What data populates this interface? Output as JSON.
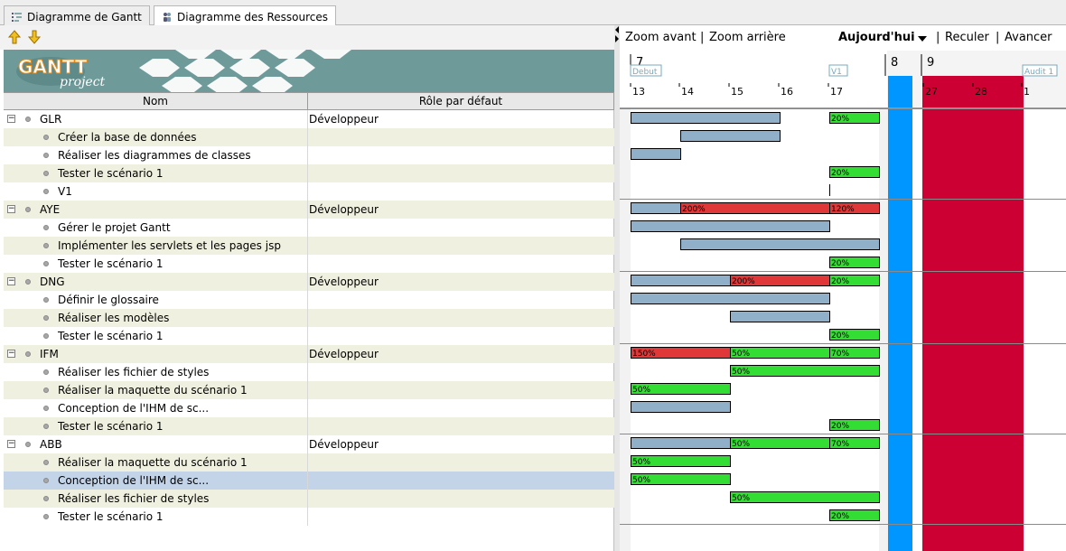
{
  "tabs": [
    {
      "label": "Diagramme de Gantt",
      "active": false
    },
    {
      "label": "Diagramme des Ressources",
      "active": true
    }
  ],
  "logo": {
    "line1": "GANTT",
    "line2": "project"
  },
  "columns": {
    "name": "Nom",
    "role": "Rôle par défaut"
  },
  "rows": [
    {
      "type": "resource",
      "name": "GLR",
      "role": "Développeur"
    },
    {
      "type": "task",
      "name": "Créer la base de données"
    },
    {
      "type": "task",
      "name": "Réaliser les diagrammes de classes"
    },
    {
      "type": "task",
      "name": "Tester le scénario 1"
    },
    {
      "type": "task",
      "name": "V1"
    },
    {
      "type": "resource",
      "name": "AYE",
      "role": "Développeur"
    },
    {
      "type": "task",
      "name": "Gérer le projet Gantt"
    },
    {
      "type": "task",
      "name": "Implémenter les servlets et les pages jsp"
    },
    {
      "type": "task",
      "name": "Tester le scénario 1"
    },
    {
      "type": "resource",
      "name": "DNG",
      "role": "Développeur"
    },
    {
      "type": "task",
      "name": "Définir le glossaire"
    },
    {
      "type": "task",
      "name": "Réaliser les modèles"
    },
    {
      "type": "task",
      "name": "Tester le scénario 1"
    },
    {
      "type": "resource",
      "name": "IFM",
      "role": "Développeur"
    },
    {
      "type": "task",
      "name": "Réaliser les fichier de styles"
    },
    {
      "type": "task",
      "name": "Réaliser la maquette du scénario 1"
    },
    {
      "type": "task",
      "name": "Conception de l'IHM de sc..."
    },
    {
      "type": "task",
      "name": "Tester le scénario 1"
    },
    {
      "type": "resource",
      "name": "ABB",
      "role": "Développeur"
    },
    {
      "type": "task",
      "name": "Réaliser la maquette du scénario 1"
    },
    {
      "type": "task",
      "name": "Conception de l'IHM de sc...",
      "selected": true
    },
    {
      "type": "task",
      "name": "Réaliser les fichier de styles"
    },
    {
      "type": "task",
      "name": "Tester le scénario 1"
    }
  ],
  "nav": {
    "zoom_in": "Zoom avant",
    "zoom_out": "Zoom arrière",
    "today": "Aujourd'hui",
    "back": "Reculer",
    "forward": "Avancer",
    "sep": "|"
  },
  "timeline": {
    "months": [
      "7",
      "8",
      "9"
    ],
    "milestones": [
      "Debut",
      "V1",
      "Audit 1"
    ],
    "days": [
      "13",
      "14",
      "15",
      "16",
      "17",
      "27",
      "28",
      "1"
    ]
  },
  "bars": [
    {
      "row": 0,
      "segs": [
        {
          "d0": 0,
          "d1": 3,
          "k": "n"
        },
        {
          "d0": 4,
          "d1": 5,
          "k": "u",
          "label": "20%"
        }
      ]
    },
    {
      "row": 1,
      "segs": [
        {
          "d0": 1,
          "d1": 3,
          "k": "n"
        }
      ]
    },
    {
      "row": 2,
      "segs": [
        {
          "d0": 0,
          "d1": 1,
          "k": "n"
        }
      ]
    },
    {
      "row": 3,
      "segs": [
        {
          "d0": 4,
          "d1": 5,
          "k": "u",
          "label": "20%"
        }
      ]
    },
    {
      "row": 4,
      "milestone": 4
    },
    {
      "row": 5,
      "segs": [
        {
          "d0": 0,
          "d1": 1,
          "k": "n"
        },
        {
          "d0": 1,
          "d1": 4,
          "k": "o",
          "label": "200%"
        },
        {
          "d0": 4,
          "d1": 5,
          "k": "o",
          "label": "120%"
        }
      ]
    },
    {
      "row": 6,
      "segs": [
        {
          "d0": 0,
          "d1": 4,
          "k": "n"
        }
      ]
    },
    {
      "row": 7,
      "segs": [
        {
          "d0": 1,
          "d1": 5,
          "k": "n"
        }
      ]
    },
    {
      "row": 8,
      "segs": [
        {
          "d0": 4,
          "d1": 5,
          "k": "u",
          "label": "20%"
        }
      ]
    },
    {
      "row": 9,
      "segs": [
        {
          "d0": 0,
          "d1": 2,
          "k": "n"
        },
        {
          "d0": 2,
          "d1": 4,
          "k": "o",
          "label": "200%"
        },
        {
          "d0": 4,
          "d1": 5,
          "k": "u",
          "label": "20%"
        }
      ]
    },
    {
      "row": 10,
      "segs": [
        {
          "d0": 0,
          "d1": 4,
          "k": "n"
        }
      ]
    },
    {
      "row": 11,
      "segs": [
        {
          "d0": 2,
          "d1": 4,
          "k": "n"
        }
      ]
    },
    {
      "row": 12,
      "segs": [
        {
          "d0": 4,
          "d1": 5,
          "k": "u",
          "label": "20%"
        }
      ]
    },
    {
      "row": 13,
      "segs": [
        {
          "d0": 0,
          "d1": 2,
          "k": "o",
          "label": "150%"
        },
        {
          "d0": 2,
          "d1": 4,
          "k": "u",
          "label": "50%"
        },
        {
          "d0": 4,
          "d1": 5,
          "k": "u",
          "label": "70%"
        }
      ]
    },
    {
      "row": 14,
      "segs": [
        {
          "d0": 2,
          "d1": 5,
          "k": "u",
          "label": "50%"
        }
      ]
    },
    {
      "row": 15,
      "segs": [
        {
          "d0": 0,
          "d1": 2,
          "k": "u",
          "label": "50%"
        }
      ]
    },
    {
      "row": 16,
      "segs": [
        {
          "d0": 0,
          "d1": 2,
          "k": "n"
        }
      ]
    },
    {
      "row": 17,
      "segs": [
        {
          "d0": 4,
          "d1": 5,
          "k": "u",
          "label": "20%"
        }
      ]
    },
    {
      "row": 18,
      "segs": [
        {
          "d0": 0,
          "d1": 2,
          "k": "n"
        },
        {
          "d0": 2,
          "d1": 4,
          "k": "u",
          "label": "50%"
        },
        {
          "d0": 4,
          "d1": 5,
          "k": "u",
          "label": "70%"
        }
      ]
    },
    {
      "row": 19,
      "segs": [
        {
          "d0": 0,
          "d1": 2,
          "k": "u",
          "label": "50%"
        }
      ]
    },
    {
      "row": 20,
      "segs": [
        {
          "d0": 0,
          "d1": 2,
          "k": "u",
          "label": "50%"
        }
      ]
    },
    {
      "row": 21,
      "segs": [
        {
          "d0": 2,
          "d1": 5,
          "k": "u",
          "label": "50%"
        }
      ]
    },
    {
      "row": 22,
      "segs": [
        {
          "d0": 4,
          "d1": 5,
          "k": "u",
          "label": "20%"
        }
      ]
    }
  ],
  "colors": {
    "normal": "#8fb0c8",
    "underload": "#33dd33",
    "overload": "#e03838",
    "today": "#0096ff",
    "holiday": "#cc0033",
    "alt_row": "#f0f0e0",
    "selected_row": "#c4d4e8",
    "banner": "#6f9a9a"
  }
}
